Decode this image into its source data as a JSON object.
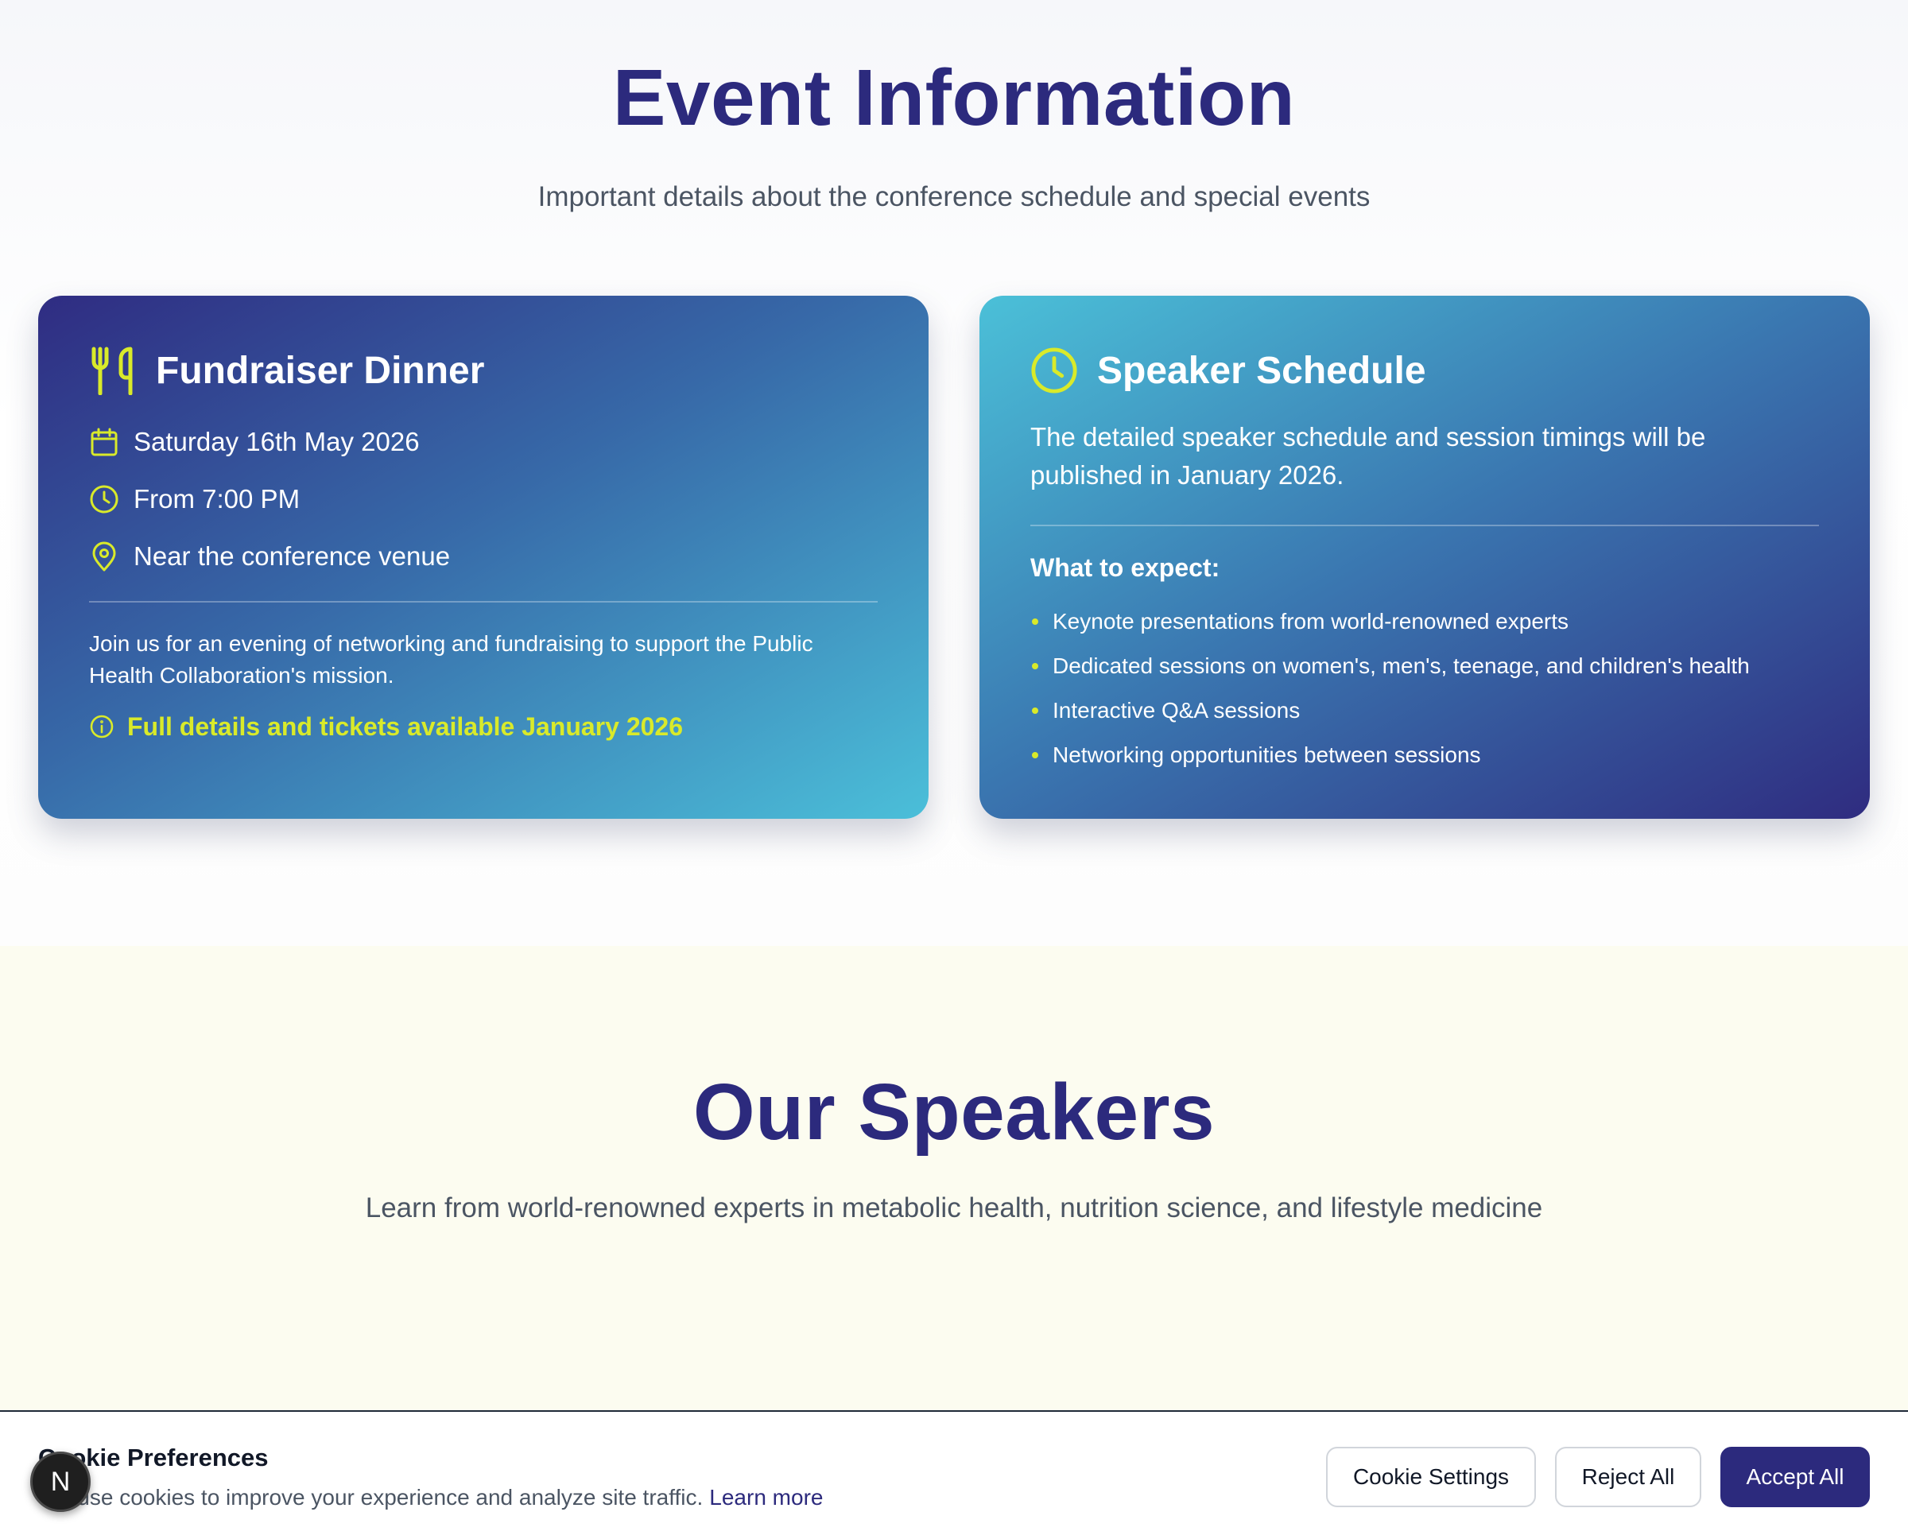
{
  "event_info": {
    "title": "Event Information",
    "subtitle": "Important details about the conference schedule and special events"
  },
  "dinner_card": {
    "icon": "utensils-icon",
    "title": "Fundraiser Dinner",
    "details": [
      {
        "icon": "calendar-icon",
        "text": "Saturday 16th May 2026"
      },
      {
        "icon": "clock-icon",
        "text": "From 7:00 PM"
      },
      {
        "icon": "map-pin-icon",
        "text": "Near the conference venue"
      }
    ],
    "description": "Join us for an evening of networking and fundraising to support the Public Health Collaboration's mission.",
    "note": "Full details and tickets available January 2026"
  },
  "schedule_card": {
    "icon": "clock-icon",
    "title": "Speaker Schedule",
    "description": "The detailed speaker schedule and session timings will be published in January 2026.",
    "expect_title": "What to expect:",
    "items": [
      "Keynote presentations from world-renowned experts",
      "Dedicated sessions on women's, men's, teenage, and children's health",
      "Interactive Q&A sessions",
      "Networking opportunities between sessions"
    ]
  },
  "speakers": {
    "title": "Our Speakers",
    "subtitle": "Learn from world-renowned experts in metabolic health, nutrition science, and lifestyle medicine"
  },
  "cookie_banner": {
    "title": "Cookie Preferences",
    "text": "We use cookies to improve your experience and analyze site traffic.",
    "link": "Learn more",
    "settings_label": "Cookie Settings",
    "reject_label": "Reject All",
    "accept_label": "Accept All"
  },
  "floating_badge": {
    "label": "N"
  },
  "colors": {
    "brand_navy": "#2c2a7d",
    "accent_yellow": "#d9ea2a",
    "card_cyan": "#4bc0d8",
    "speakers_bg": "#fcfcf0"
  }
}
